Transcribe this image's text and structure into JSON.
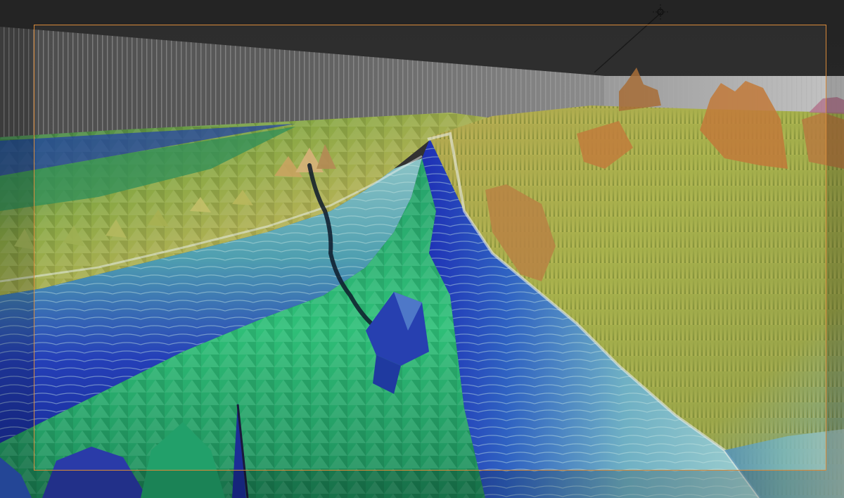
{
  "viewport": {
    "name": "3D Viewport",
    "mode": "camera-view",
    "shading": "vertex-color",
    "subject": "terrain-height-map",
    "show_camera_frame": true,
    "show_passepartout": true
  },
  "colors": {
    "background": "#3b3b3b",
    "camera_frame": "#d98a3a",
    "wall": "#5a5a5a",
    "wall_stripe": "#9a9a9a",
    "height_low": "#1a2fb0",
    "height_mid_low": "#1e8f7a",
    "height_mid": "#2ec27a",
    "height_mid_high": "#7fb0b8",
    "height_high": "#a8b04a",
    "height_peak": "#c0743a",
    "snow": "#e8e8e8"
  },
  "icons": {
    "object_origin": "origin-marker-icon"
  }
}
